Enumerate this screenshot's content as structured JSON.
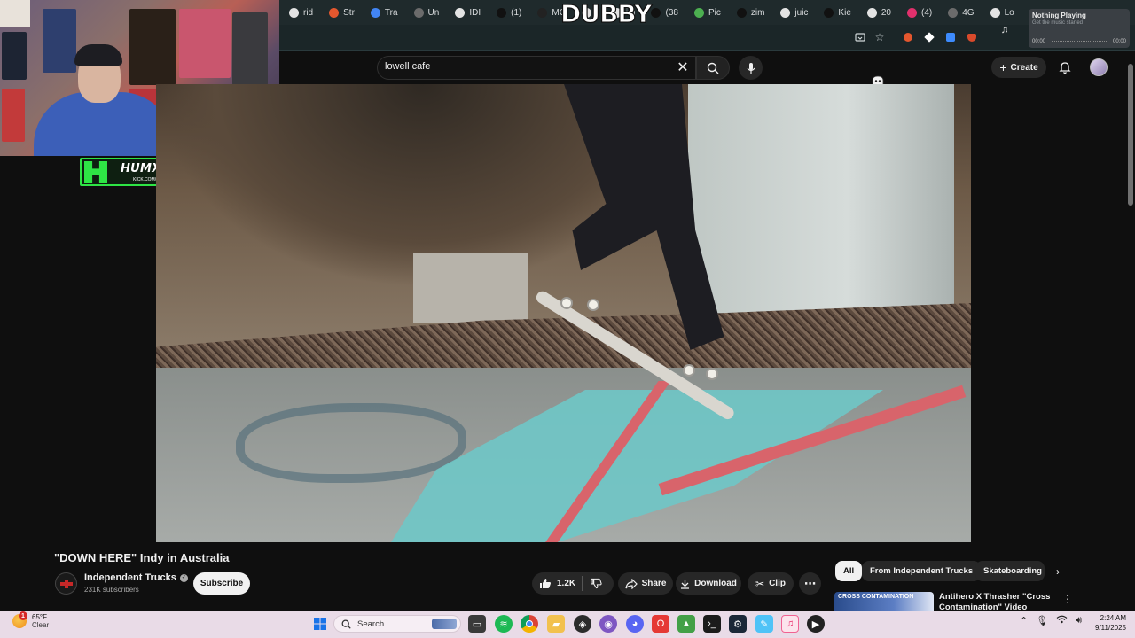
{
  "browser": {
    "brand": "DUBBY",
    "tabs": [
      {
        "label": "rid",
        "color": "#e3e3e3"
      },
      {
        "label": "Str",
        "color": "#e4572e"
      },
      {
        "label": "Tra",
        "color": "#4285f4"
      },
      {
        "label": "Un",
        "color": "#6b6b6b"
      },
      {
        "label": "IDI",
        "color": "#e3e3e3"
      },
      {
        "label": "(1)",
        "color": "#111111"
      },
      {
        "label": "MC",
        "color": "#222222"
      },
      {
        "label": "",
        "color": "#e3e3e3"
      },
      {
        "label": "im",
        "color": "#e3e3e3"
      },
      {
        "label": "(38",
        "color": "#111111"
      },
      {
        "label": "Pic",
        "color": "#4caf50"
      },
      {
        "label": "zim",
        "color": "#111111"
      },
      {
        "label": "juic",
        "color": "#e3e3e3"
      },
      {
        "label": "Kie",
        "color": "#111111"
      },
      {
        "label": "20",
        "color": "#e3e3e3"
      },
      {
        "label": "(4)",
        "color": "#e1306c"
      },
      {
        "label": "4G",
        "color": "#6b6b6b"
      },
      {
        "label": "Lo",
        "color": "#e3e3e3"
      }
    ]
  },
  "now_playing": {
    "title": "Nothing Playing",
    "subtitle": "Get the music started",
    "time_start": "00:00",
    "time_end": "00:00"
  },
  "stream_tag": {
    "name": "HUMXNGHXST",
    "url": "KICK.COM/HUMXNGHXST"
  },
  "masthead": {
    "search_query": "lowell cafe",
    "create_label": "Create"
  },
  "video": {
    "title": "\"DOWN HERE\" Indy in Australia",
    "channel_name": "Independent Trucks",
    "subscribers": "231K subscribers",
    "subscribe_label": "Subscribe",
    "likes": "1.2K",
    "share_label": "Share",
    "download_label": "Download",
    "clip_label": "Clip"
  },
  "chips": [
    "All",
    "From Independent Trucks",
    "Skateboarding"
  ],
  "recommendation": {
    "title": "Antihero X Thrasher \"Cross Contamination\" Video",
    "thumb_text": "CROSS CONTAMINATION"
  },
  "taskbar": {
    "temperature": "65°F",
    "condition": "Clear",
    "weather_badge": "1",
    "search_label": "Search",
    "time": "2:24 AM",
    "date": "9/11/2025"
  },
  "colors": {
    "yt_bg": "#0f0f0f",
    "pill_bg": "#272727",
    "tag_green": "#2ee545",
    "taskbar_bg": "#e9dbe7"
  }
}
